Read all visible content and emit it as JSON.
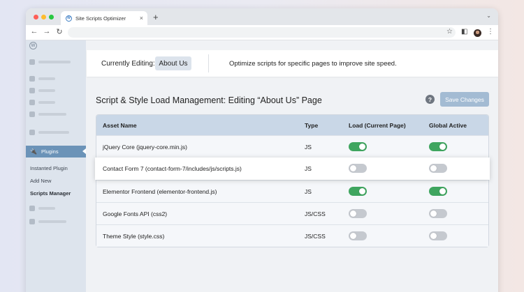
{
  "browser": {
    "tab_title": "Site Scripts Optimizer",
    "tab_close": "×",
    "new_tab": "+",
    "tab_menu": "⌄",
    "nav": {
      "back": "←",
      "forward": "→",
      "reload": "↻"
    },
    "toolbar_icons": {
      "star": "☆",
      "sidebar": "◧",
      "menu": "⋮"
    }
  },
  "sidebar": {
    "active_item": "Plugins",
    "submenu": [
      "Instanted Plugin",
      "Add New",
      "Scripts Manager"
    ],
    "current_submenu": "Scripts Manager"
  },
  "header": {
    "editing_label": "Currently Editing:",
    "editing_page": "About Us",
    "description": "Optimize scripts for specific pages to improve site speed."
  },
  "main": {
    "title": "Script & Style Load Management: Editing “About Us” Page",
    "help_icon": "?",
    "save_button": "Save Changes"
  },
  "table": {
    "columns": [
      "Asset Name",
      "Type",
      "Load (Current Page)",
      "Global Active"
    ],
    "rows": [
      {
        "name": "jQuery Core (jquery-core.min.js)",
        "type": "JS",
        "load": true,
        "global": true
      },
      {
        "name": "Contact Form 7 (contact-form-7/includes/js/scripts.js)",
        "type": "JS",
        "load": false,
        "global": false
      },
      {
        "name": "Elementor Frontend (elementor-frontend.js)",
        "type": "JS",
        "load": true,
        "global": true
      },
      {
        "name": "Google Fonts API (css2)",
        "type": "JS/CSS",
        "load": false,
        "global": false
      },
      {
        "name": "Theme Style (style.css)",
        "type": "JS/CSS",
        "load": false,
        "global": false
      }
    ]
  },
  "colors": {
    "accent": "#6b93b8",
    "toggle_on": "#3fa55f",
    "toggle_off": "#c5c9cf",
    "save_button": "#a3bbd3",
    "table_header": "#c9d7e7"
  }
}
